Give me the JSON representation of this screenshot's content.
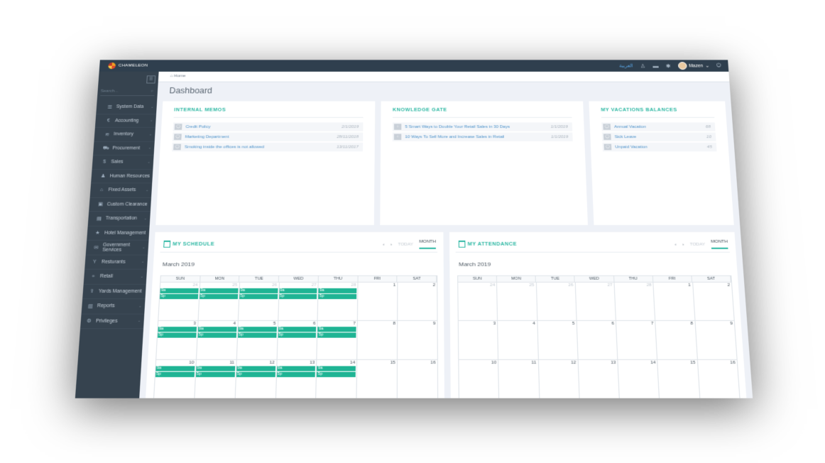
{
  "app": {
    "brand": "CHAMELEON"
  },
  "topbar": {
    "language": "العربية",
    "user_name": "Mazen"
  },
  "sidebar": {
    "search_placeholder": "Search...",
    "items": [
      {
        "label": "System Data",
        "icon": "database-icon"
      },
      {
        "label": "Accounting",
        "icon": "currency-icon"
      },
      {
        "label": "Inventory",
        "icon": "layers-icon"
      },
      {
        "label": "Procurement",
        "icon": "cart-icon"
      },
      {
        "label": "Sales",
        "icon": "dollar-icon"
      },
      {
        "label": "Human Resources",
        "icon": "person-icon"
      },
      {
        "label": "Fixed Assets",
        "icon": "building-icon"
      },
      {
        "label": "Custom Clearance",
        "icon": "box-icon"
      },
      {
        "label": "Transportation",
        "icon": "truck-icon"
      },
      {
        "label": "Hotel Management",
        "icon": "star-icon"
      },
      {
        "label": "Government Services",
        "icon": "document-icon"
      },
      {
        "label": "Resturants",
        "icon": "glass-icon"
      },
      {
        "label": "Retail",
        "icon": "store-icon"
      },
      {
        "label": "Yards Management",
        "icon": "upload-icon"
      },
      {
        "label": "Reports",
        "icon": "report-icon"
      },
      {
        "label": "Privileges",
        "icon": "gear-icon"
      }
    ]
  },
  "breadcrumb": {
    "home": "Home"
  },
  "page": {
    "title": "Dashboard"
  },
  "memos": {
    "title": "INTERNAL MEMOS",
    "items": [
      {
        "label": "Credit Policy",
        "value": "2/1/2019"
      },
      {
        "label": "Marketing Department",
        "value": "28/11/2018"
      },
      {
        "label": "Smoking inside the offices is not allowed",
        "value": "13/11/2017"
      }
    ]
  },
  "knowledge": {
    "title": "KNOWLEDGE GATE",
    "items": [
      {
        "label": "5 Smart Ways to Double Your Retail Sales in 30 Days",
        "value": "1/1/2019"
      },
      {
        "label": "10 Ways To Sell More and Increase Sales in Retail",
        "value": "1/1/2019"
      }
    ]
  },
  "vacations": {
    "title": "MY VACATIONS BALANCES",
    "items": [
      {
        "label": "Annual Vacation",
        "value": "68"
      },
      {
        "label": "Sick Leave",
        "value": "10"
      },
      {
        "label": "Unpaid Vacation",
        "value": "45"
      }
    ]
  },
  "calendar_common": {
    "prev": "‹",
    "next": "›",
    "today": "TODAY",
    "month": "MONTH",
    "month_label": "March 2019",
    "days": [
      "SUN",
      "MON",
      "TUE",
      "WED",
      "THU",
      "FRI",
      "SAT"
    ]
  },
  "schedule": {
    "title": "MY SCHEDULE",
    "weeks": [
      [
        {
          "d": "24",
          "o": true,
          "e": true
        },
        {
          "d": "25",
          "o": true,
          "e": true
        },
        {
          "d": "26",
          "o": true,
          "e": true
        },
        {
          "d": "27",
          "o": true,
          "e": true
        },
        {
          "d": "28",
          "o": true,
          "e": true
        },
        {
          "d": "1"
        },
        {
          "d": "2"
        }
      ],
      [
        {
          "d": "3",
          "e": true
        },
        {
          "d": "4",
          "e": true
        },
        {
          "d": "5",
          "e": true
        },
        {
          "d": "6",
          "e": true
        },
        {
          "d": "7",
          "e": true
        },
        {
          "d": "8"
        },
        {
          "d": "9"
        }
      ],
      [
        {
          "d": "10",
          "e": true
        },
        {
          "d": "11",
          "e": true
        },
        {
          "d": "12",
          "e": true
        },
        {
          "d": "13",
          "e": true
        },
        {
          "d": "14",
          "e": true
        },
        {
          "d": "15"
        },
        {
          "d": "16"
        }
      ]
    ],
    "event_start": "9a",
    "event_end": "5p"
  },
  "attendance": {
    "title": "MY ATTENDANCE",
    "weeks": [
      [
        {
          "d": "24",
          "o": true
        },
        {
          "d": "25",
          "o": true
        },
        {
          "d": "26",
          "o": true
        },
        {
          "d": "27",
          "o": true
        },
        {
          "d": "28",
          "o": true
        },
        {
          "d": "1"
        },
        {
          "d": "2"
        }
      ],
      [
        {
          "d": "3"
        },
        {
          "d": "4"
        },
        {
          "d": "5"
        },
        {
          "d": "6"
        },
        {
          "d": "7"
        },
        {
          "d": "8"
        },
        {
          "d": "9"
        }
      ],
      [
        {
          "d": "10"
        },
        {
          "d": "11"
        },
        {
          "d": "12"
        },
        {
          "d": "13"
        },
        {
          "d": "14"
        },
        {
          "d": "15"
        },
        {
          "d": "16"
        }
      ]
    ]
  },
  "colors": {
    "accent": "#2fb8a4",
    "event": "#1fb494",
    "topbar": "#2f3f4e",
    "sidebar": "#36434f"
  }
}
